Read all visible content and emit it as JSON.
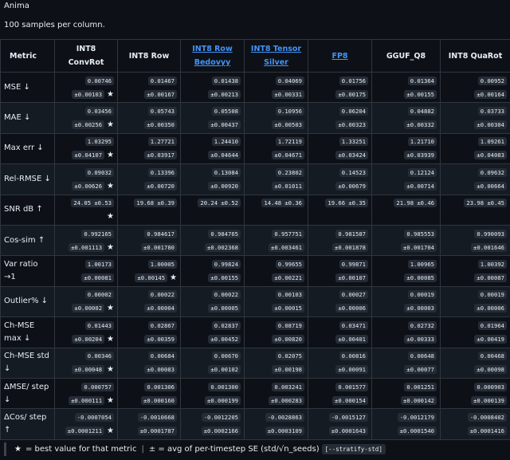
{
  "title": "Anima",
  "subtitle": "100 samples per column.",
  "columns": [
    {
      "label": "Metric",
      "link": false
    },
    {
      "label": "INT8 ConvRot",
      "link": false
    },
    {
      "label": "INT8 Row",
      "link": false
    },
    {
      "label": "INT8 Row Bedovyy",
      "link": true
    },
    {
      "label": "INT8 Tensor Silver",
      "link": true
    },
    {
      "label": "FP8",
      "link": true
    },
    {
      "label": "GGUF_Q8",
      "link": false
    },
    {
      "label": "INT8 QuaRot",
      "link": false
    }
  ],
  "rows": [
    {
      "metric": "MSE ↓",
      "cells": [
        {
          "v": "0.00746",
          "e": "±0.00103",
          "best": true
        },
        {
          "v": "0.01467",
          "e": "±0.00167",
          "best": false
        },
        {
          "v": "0.01438",
          "e": "±0.00213",
          "best": false
        },
        {
          "v": "0.04069",
          "e": "±0.00331",
          "best": false
        },
        {
          "v": "0.01756",
          "e": "±0.00175",
          "best": false
        },
        {
          "v": "0.01364",
          "e": "±0.00155",
          "best": false
        },
        {
          "v": "0.00952",
          "e": "±0.00164",
          "best": false
        }
      ]
    },
    {
      "metric": "MAE ↓",
      "cells": [
        {
          "v": "0.03456",
          "e": "±0.00256",
          "best": true
        },
        {
          "v": "0.05743",
          "e": "±0.00350",
          "best": false
        },
        {
          "v": "0.05508",
          "e": "±0.00437",
          "best": false
        },
        {
          "v": "0.10956",
          "e": "±0.00503",
          "best": false
        },
        {
          "v": "0.06204",
          "e": "±0.00323",
          "best": false
        },
        {
          "v": "0.04882",
          "e": "±0.00332",
          "best": false
        },
        {
          "v": "0.03733",
          "e": "±0.00304",
          "best": false
        }
      ]
    },
    {
      "metric": "Max err ↓",
      "cells": [
        {
          "v": "1.03295",
          "e": "±0.04107",
          "best": true
        },
        {
          "v": "1.27721",
          "e": "±0.03917",
          "best": false
        },
        {
          "v": "1.24410",
          "e": "±0.04644",
          "best": false
        },
        {
          "v": "1.72119",
          "e": "±0.04671",
          "best": false
        },
        {
          "v": "1.33251",
          "e": "±0.03424",
          "best": false
        },
        {
          "v": "1.21710",
          "e": "±0.03939",
          "best": false
        },
        {
          "v": "1.09261",
          "e": "±0.04083",
          "best": false
        }
      ]
    },
    {
      "metric": "Rel-RMSE ↓",
      "cells": [
        {
          "v": "0.09032",
          "e": "±0.00626",
          "best": true
        },
        {
          "v": "0.13396",
          "e": "±0.00720",
          "best": false
        },
        {
          "v": "0.13084",
          "e": "±0.00920",
          "best": false
        },
        {
          "v": "0.23802",
          "e": "±0.01011",
          "best": false
        },
        {
          "v": "0.14523",
          "e": "±0.00679",
          "best": false
        },
        {
          "v": "0.12124",
          "e": "±0.00714",
          "best": false
        },
        {
          "v": "0.09632",
          "e": "±0.00664",
          "best": false
        }
      ]
    },
    {
      "metric": "SNR dB ↑",
      "cells": [
        {
          "v": "24.05 ±0.53",
          "e": "",
          "best": true
        },
        {
          "v": "19.68 ±0.39",
          "e": "",
          "best": false
        },
        {
          "v": "20.24 ±0.52",
          "e": "",
          "best": false
        },
        {
          "v": "14.48 ±0.36",
          "e": "",
          "best": false
        },
        {
          "v": "19.66 ±0.35",
          "e": "",
          "best": false
        },
        {
          "v": "21.98 ±0.46",
          "e": "",
          "best": false
        },
        {
          "v": "23.98 ±0.45",
          "e": "",
          "best": false
        }
      ]
    },
    {
      "metric": "Cos-sim ↑",
      "cells": [
        {
          "v": "0.992165",
          "e": "±0.001113",
          "best": true
        },
        {
          "v": "0.984617",
          "e": "±0.001780",
          "best": false
        },
        {
          "v": "0.984765",
          "e": "±0.002368",
          "best": false
        },
        {
          "v": "0.957751",
          "e": "±0.003461",
          "best": false
        },
        {
          "v": "0.981587",
          "e": "±0.001878",
          "best": false
        },
        {
          "v": "0.985553",
          "e": "±0.001704",
          "best": false
        },
        {
          "v": "0.990093",
          "e": "±0.001646",
          "best": false
        }
      ]
    },
    {
      "metric": "Var ratio →1",
      "cells": [
        {
          "v": "1.00173",
          "e": "±0.00081",
          "best": false
        },
        {
          "v": "1.00005",
          "e": "±0.00145",
          "best": true
        },
        {
          "v": "0.99824",
          "e": "±0.00155",
          "best": false
        },
        {
          "v": "0.99655",
          "e": "±0.00221",
          "best": false
        },
        {
          "v": "0.99871",
          "e": "±0.00107",
          "best": false
        },
        {
          "v": "1.00965",
          "e": "±0.00085",
          "best": false
        },
        {
          "v": "1.00392",
          "e": "±0.00087",
          "best": false
        }
      ]
    },
    {
      "metric": "Outlier% ↓",
      "cells": [
        {
          "v": "0.00002",
          "e": "±0.00002",
          "best": true
        },
        {
          "v": "0.00022",
          "e": "±0.00004",
          "best": false
        },
        {
          "v": "0.00022",
          "e": "±0.00005",
          "best": false
        },
        {
          "v": "0.00103",
          "e": "±0.00015",
          "best": false
        },
        {
          "v": "0.00027",
          "e": "±0.00006",
          "best": false
        },
        {
          "v": "0.00019",
          "e": "±0.00003",
          "best": false
        },
        {
          "v": "0.00019",
          "e": "±0.00006",
          "best": false
        }
      ]
    },
    {
      "metric": "Ch-MSE max ↓",
      "cells": [
        {
          "v": "0.01443",
          "e": "±0.00204",
          "best": true
        },
        {
          "v": "0.02867",
          "e": "±0.00359",
          "best": false
        },
        {
          "v": "0.02837",
          "e": "±0.00452",
          "best": false
        },
        {
          "v": "0.08719",
          "e": "±0.00820",
          "best": false
        },
        {
          "v": "0.03471",
          "e": "±0.00401",
          "best": false
        },
        {
          "v": "0.02732",
          "e": "±0.00333",
          "best": false
        },
        {
          "v": "0.01964",
          "e": "±0.00419",
          "best": false
        }
      ]
    },
    {
      "metric": "Ch-MSE std ↓",
      "cells": [
        {
          "v": "0.00346",
          "e": "±0.00048",
          "best": true
        },
        {
          "v": "0.00684",
          "e": "±0.00083",
          "best": false
        },
        {
          "v": "0.00670",
          "e": "±0.00102",
          "best": false
        },
        {
          "v": "0.02075",
          "e": "±0.00198",
          "best": false
        },
        {
          "v": "0.00816",
          "e": "±0.00091",
          "best": false
        },
        {
          "v": "0.00648",
          "e": "±0.00077",
          "best": false
        },
        {
          "v": "0.00468",
          "e": "±0.00098",
          "best": false
        }
      ]
    },
    {
      "metric": "ΔMSE/ step ↓",
      "cells": [
        {
          "v": "0.000757",
          "e": "±0.000111",
          "best": true
        },
        {
          "v": "0.001306",
          "e": "±0.000160",
          "best": false
        },
        {
          "v": "0.001300",
          "e": "±0.000199",
          "best": false
        },
        {
          "v": "0.003241",
          "e": "±0.000283",
          "best": false
        },
        {
          "v": "0.001577",
          "e": "±0.000154",
          "best": false
        },
        {
          "v": "0.001251",
          "e": "±0.000142",
          "best": false
        },
        {
          "v": "0.000903",
          "e": "±0.000139",
          "best": false
        }
      ]
    },
    {
      "metric": "ΔCos/ step ↑",
      "cells": [
        {
          "v": "-0.0007054",
          "e": "±0.0001211",
          "best": true
        },
        {
          "v": "-0.0010668",
          "e": "±0.0001787",
          "best": false
        },
        {
          "v": "-0.0012205",
          "e": "±0.0002166",
          "best": false
        },
        {
          "v": "-0.0028863",
          "e": "±0.0003109",
          "best": false
        },
        {
          "v": "-0.0015127",
          "e": "±0.0001643",
          "best": false
        },
        {
          "v": "-0.0012179",
          "e": "±0.0001540",
          "best": false
        },
        {
          "v": "-0.0008402",
          "e": "±0.0001416",
          "best": false
        }
      ]
    }
  ],
  "legend": {
    "star": "★",
    "best_text": "= best value for that metric",
    "separator": "|",
    "pm_text": "± = avg of per-timestep SE (std/√n_seeds)",
    "code": "[--stratify-std]"
  }
}
